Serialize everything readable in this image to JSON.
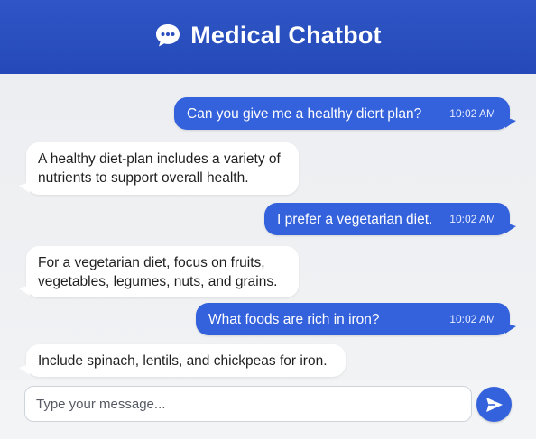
{
  "header": {
    "title": "Medical Chatbot",
    "icon": "chat-bubble-icon"
  },
  "messages": [
    {
      "sender": "user",
      "text": "Can you give me a healthy diert plan?",
      "time": "10:02 AM"
    },
    {
      "sender": "bot",
      "lines": [
        "A healthy diet-plan includes a variety of",
        "nutrients to support overall health."
      ]
    },
    {
      "sender": "user",
      "text": "I prefer a vegetarian diet.",
      "time": "10:02 AM"
    },
    {
      "sender": "bot",
      "lines": [
        "For a vegetarian diet, focus on fruits,",
        "vegetables, legumes, nuts, and grains."
      ]
    },
    {
      "sender": "user",
      "text": "What foods are rich in iron?",
      "time": "10:02 AM"
    },
    {
      "sender": "bot",
      "lines": [
        "Include spinach, lentils, and chickpeas for iron."
      ]
    }
  ],
  "composer": {
    "placeholder": "Type your message...",
    "send_icon": "send-icon"
  },
  "colors": {
    "header": "#2a4fc0",
    "user_bubble": "#3461dc",
    "bot_bubble": "#ffffff",
    "background": "#eeeff1"
  }
}
